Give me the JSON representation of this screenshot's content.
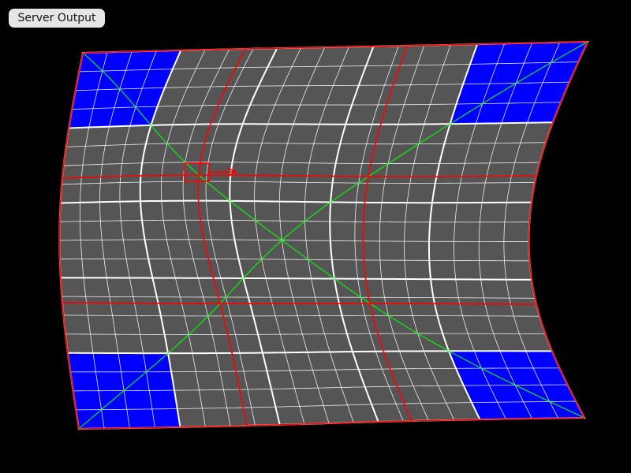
{
  "toolbar": {
    "server_output_label": "Server Output"
  },
  "grid": {
    "cols": 20,
    "rows": 20,
    "major_every": 4,
    "blue_corner_cells": 4
  },
  "colors": {
    "background": "#000000",
    "surface": "#555555",
    "grid_line": "#ffffff",
    "control_line": "#ff0000",
    "diagonal": "#00ff00",
    "corner_fill": "#0000ff",
    "button_bg": "#e6e6e6",
    "button_text": "#111111"
  },
  "icons": {
    "handle": "selected-control-point-icon",
    "arrow": "direction-arrow-icon"
  }
}
